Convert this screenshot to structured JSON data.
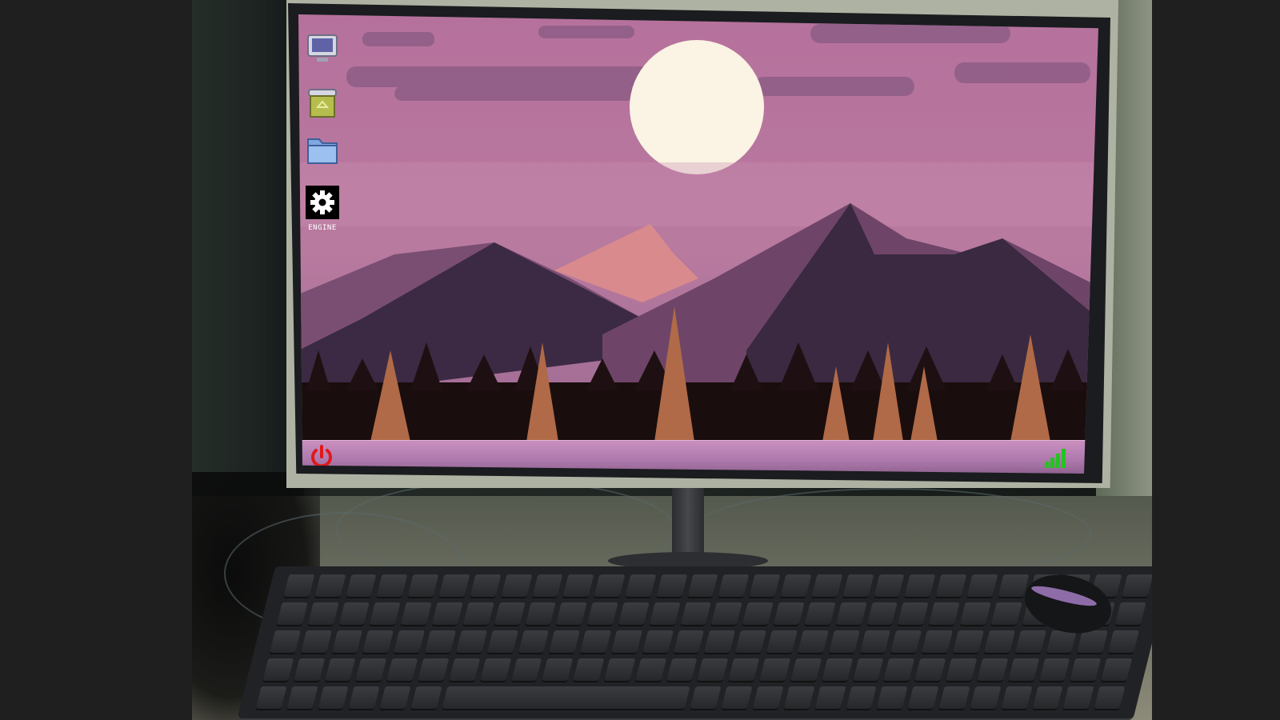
{
  "desktop": {
    "icons": [
      {
        "id": "computer",
        "label": ""
      },
      {
        "id": "recycle-bin",
        "label": ""
      },
      {
        "id": "folder",
        "label": ""
      },
      {
        "id": "engine",
        "label": "ENGINE"
      }
    ]
  },
  "taskbar": {
    "power_icon": "power-icon",
    "network_icon": "signal-bars-icon"
  },
  "colors": {
    "sky": "#b9709b",
    "moon": "#fbf3e3",
    "taskbar": "#b07aae",
    "power": "#e01818",
    "signal": "#22c51f"
  }
}
